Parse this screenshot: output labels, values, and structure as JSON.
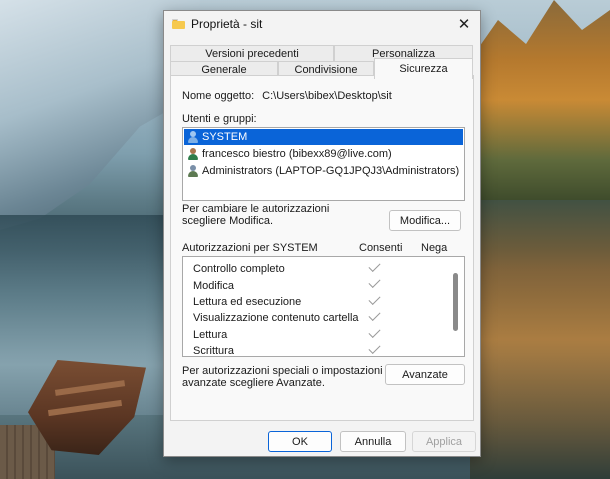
{
  "window": {
    "title": "Proprietà - sit",
    "close_glyph": "✕"
  },
  "tabs": {
    "row1": [
      "Versioni precedenti",
      "Personalizza"
    ],
    "row2": [
      "Generale",
      "Condivisione",
      "Sicurezza"
    ],
    "active": "Sicurezza"
  },
  "security": {
    "object_label": "Nome oggetto:",
    "object_value": "C:\\Users\\bibex\\Desktop\\sit",
    "users_label": "Utenti e gruppi:",
    "users": [
      {
        "name": "SYSTEM",
        "icon": "system-user-icon",
        "selected": true
      },
      {
        "name": "francesco biestro (bibexx89@live.com)",
        "icon": "user-icon",
        "selected": false
      },
      {
        "name": "Administrators (LAPTOP-GQ1JPQJ3\\Administrators)",
        "icon": "group-icon",
        "selected": false
      }
    ],
    "change_hint_line1": "Per cambiare le autorizzazioni",
    "change_hint_line2": "scegliere Modifica.",
    "modify_button": "Modifica...",
    "perm_header": "Autorizzazioni per SYSTEM",
    "allow_header": "Consenti",
    "deny_header": "Nega",
    "permissions": [
      {
        "name": "Controllo completo",
        "allow": true,
        "deny": false
      },
      {
        "name": "Modifica",
        "allow": true,
        "deny": false
      },
      {
        "name": "Lettura ed esecuzione",
        "allow": true,
        "deny": false
      },
      {
        "name": "Visualizzazione contenuto cartella",
        "allow": true,
        "deny": false
      },
      {
        "name": "Lettura",
        "allow": true,
        "deny": false
      },
      {
        "name": "Scrittura",
        "allow": true,
        "deny": false
      }
    ],
    "advanced_hint_line1": "Per autorizzazioni speciali o impostazioni",
    "advanced_hint_line2": "avanzate scegliere Avanzate.",
    "advanced_button": "Avanzate"
  },
  "footer": {
    "ok": "OK",
    "cancel": "Annulla",
    "apply": "Applica",
    "apply_enabled": false
  },
  "colors": {
    "selection": "#0a64d8",
    "folder": "#f6c94e",
    "check_disabled": "#9a9a9a"
  }
}
